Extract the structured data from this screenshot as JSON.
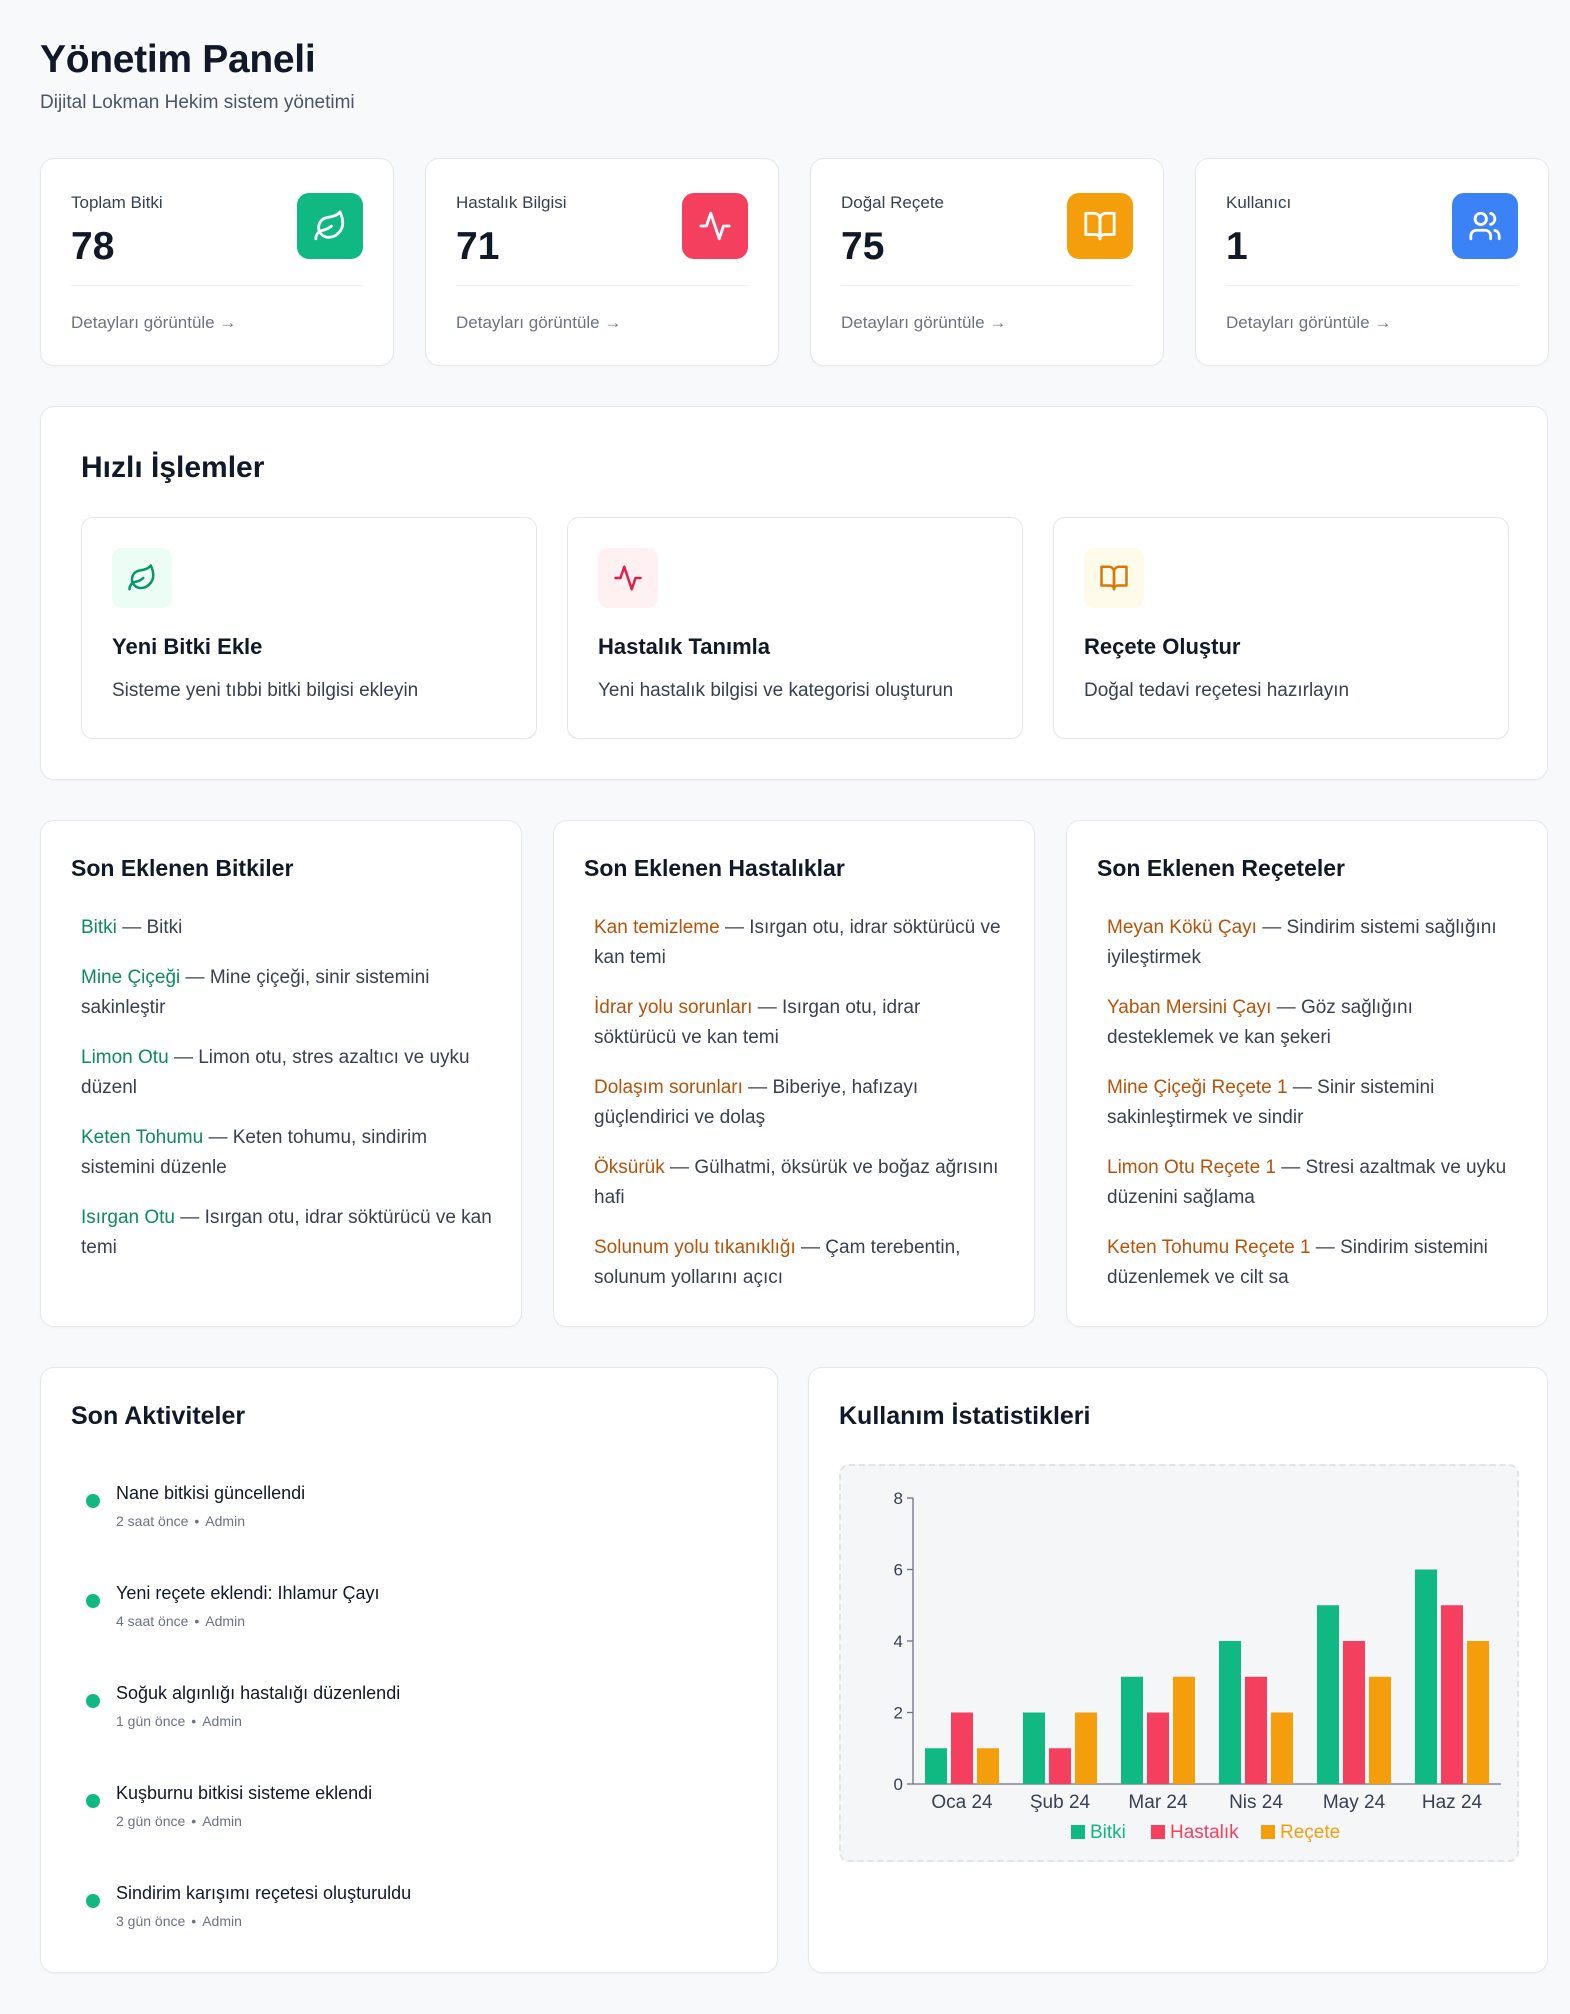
{
  "header": {
    "title": "Yönetim Paneli",
    "subtitle": "Dijital Lokman Hekim sistem yönetimi"
  },
  "stats": [
    {
      "label": "Toplam Bitki",
      "value": "78",
      "link": "Detayları görüntüle →",
      "icon": "leaf-icon",
      "color": "#10b981"
    },
    {
      "label": "Hastalık Bilgisi",
      "value": "71",
      "link": "Detayları görüntüle →",
      "icon": "pulse-icon",
      "color": "#f43f5e"
    },
    {
      "label": "Doğal Reçete",
      "value": "75",
      "link": "Detayları görüntüle →",
      "icon": "book-icon",
      "color": "#f59e0b"
    },
    {
      "label": "Kullanıcı",
      "value": "1",
      "link": "Detayları görüntüle →",
      "icon": "users-icon",
      "color": "#3b82f6"
    }
  ],
  "quick_actions": {
    "title": "Hızlı İşlemler",
    "items": [
      {
        "title": "Yeni Bitki Ekle",
        "desc": "Sisteme yeni tıbbi bitki bilgisi ekleyin",
        "icon": "leaf-icon"
      },
      {
        "title": "Hastalık Tanımla",
        "desc": "Yeni hastalık bilgisi ve kategorisi oluşturun",
        "icon": "pulse-icon"
      },
      {
        "title": "Reçete Oluştur",
        "desc": "Doğal tedavi reçetesi hazırlayın",
        "icon": "book-icon"
      }
    ]
  },
  "recent_plants": {
    "title": "Son Eklenen Bitkiler",
    "items": [
      {
        "name": "Bitki",
        "desc": "Bitki"
      },
      {
        "name": "Mine Çiçeği",
        "desc": "Mine çiçeği, sinir sistemini sakinleştir"
      },
      {
        "name": "Limon Otu",
        "desc": "Limon otu, stres azaltıcı ve uyku düzenl"
      },
      {
        "name": "Keten Tohumu",
        "desc": "Keten tohumu, sindirim sistemini düzenle"
      },
      {
        "name": "Isırgan Otu",
        "desc": "Isırgan otu, idrar söktürücü ve kan temi"
      }
    ]
  },
  "recent_diseases": {
    "title": "Son Eklenen Hastalıklar",
    "items": [
      {
        "name": "Kan temizleme",
        "desc": "Isırgan otu, idrar söktürücü ve kan temi"
      },
      {
        "name": "İdrar yolu sorunları",
        "desc": "Isırgan otu, idrar söktürücü ve kan temi"
      },
      {
        "name": "Dolaşım sorunları",
        "desc": "Biberiye, hafızayı güçlendirici ve dolaş"
      },
      {
        "name": "Öksürük",
        "desc": "Gülhatmi, öksürük ve boğaz ağrısını hafi"
      },
      {
        "name": "Solunum yolu tıkanıklığı",
        "desc": "Çam terebentin, solunum yollarını açıcı"
      }
    ]
  },
  "recent_recipes": {
    "title": "Son Eklenen Reçeteler",
    "items": [
      {
        "name": "Meyan Kökü Çayı",
        "desc": "Sindirim sistemi sağlığını iyileştirmek"
      },
      {
        "name": "Yaban Mersini Çayı",
        "desc": "Göz sağlığını desteklemek ve kan şekeri"
      },
      {
        "name": "Mine Çiçeği Reçete 1",
        "desc": "Sinir sistemini sakinleştirmek ve sindir"
      },
      {
        "name": "Limon Otu Reçete 1",
        "desc": "Stresi azaltmak ve uyku düzenini sağlama"
      },
      {
        "name": "Keten Tohumu Reçete 1",
        "desc": "Sindirim sistemini düzenlemek ve cilt sa"
      }
    ]
  },
  "separator": "—",
  "activities": {
    "title": "Son Aktiviteler",
    "items": [
      {
        "text": "Nane bitkisi güncellendi",
        "time": "2 saat önce",
        "user": "Admin"
      },
      {
        "text": "Yeni reçete eklendi: Ihlamur Çayı",
        "time": "4 saat önce",
        "user": "Admin"
      },
      {
        "text": "Soğuk algınlığı hastalığı düzenlendi",
        "time": "1 gün önce",
        "user": "Admin"
      },
      {
        "text": "Kuşburnu bitkisi sisteme eklendi",
        "time": "2 gün önce",
        "user": "Admin"
      },
      {
        "text": "Sindirim karışımı reçetesi oluşturuldu",
        "time": "3 gün önce",
        "user": "Admin"
      }
    ],
    "meta_sep": "•"
  },
  "usage": {
    "title": "Kullanım İstatistikleri"
  },
  "chart_data": {
    "type": "bar",
    "categories": [
      "Oca 24",
      "Şub 24",
      "Mar 24",
      "Nis 24",
      "May 24",
      "Haz 24"
    ],
    "series": [
      {
        "name": "Bitki",
        "values": [
          1,
          2,
          3,
          4,
          5,
          6
        ],
        "color": "#10b981"
      },
      {
        "name": "Hastalık",
        "values": [
          2,
          1,
          2,
          3,
          4,
          5
        ],
        "color": "#f43f5e"
      },
      {
        "name": "Reçete",
        "values": [
          1,
          2,
          3,
          2,
          3,
          4
        ],
        "color": "#f59e0b"
      }
    ],
    "ylim": [
      0,
      8
    ],
    "yticks": [
      0,
      2,
      4,
      6,
      8
    ],
    "legend": "bottom",
    "grid": false
  }
}
